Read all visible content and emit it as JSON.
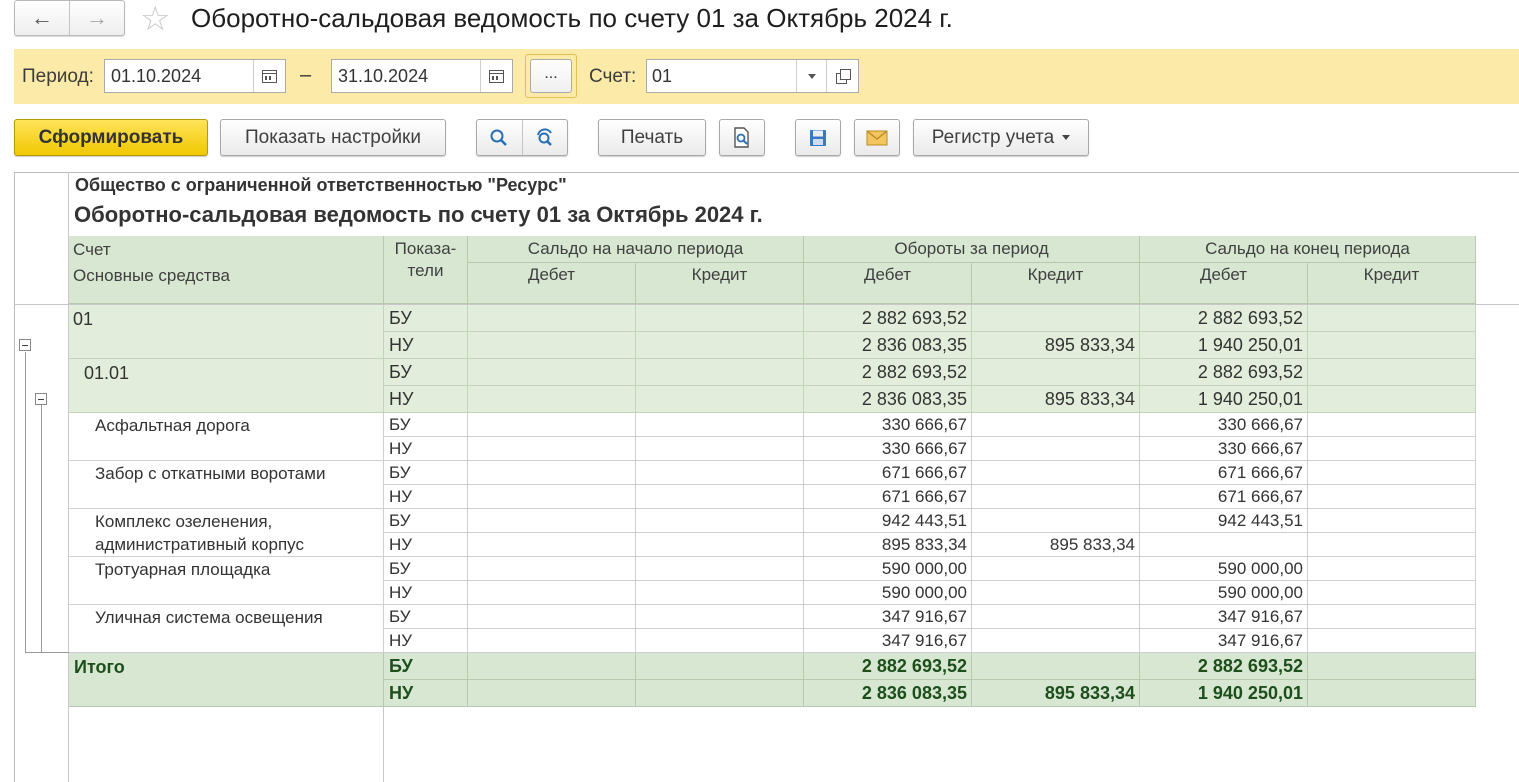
{
  "window": {
    "title": "Оборотно-сальдовая ведомость по счету 01 за Октябрь 2024 г.",
    "back_icon": "arrow-left",
    "forward_icon": "arrow-right",
    "favorite_icon": "star"
  },
  "filters": {
    "period_label": "Период:",
    "date_from": "01.10.2024",
    "date_to": "31.10.2024",
    "dash": "–",
    "period_choose": "...",
    "account_label": "Счет:",
    "account": "01"
  },
  "toolbar": {
    "generate": "Сформировать",
    "show_settings": "Показать настройки",
    "print": "Печать",
    "registry": "Регистр учета"
  },
  "report": {
    "organization": "Общество с ограниченной ответственностью \"Ресурс\"",
    "title": "Оборотно-сальдовая ведомость по счету 01 за Октябрь 2024 г.",
    "header": {
      "account": "Счет",
      "subconto": "Основные средства",
      "indicators_1": "Показа-",
      "indicators_2": "тели",
      "opening": "Сальдо на начало периода",
      "turnover": "Обороты за период",
      "closing": "Сальдо на конец периода",
      "debit": "Дебет",
      "credit": "Кредит"
    },
    "rows": [
      {
        "name": "01",
        "bu": {
          "t_dt": "2 882 693,52",
          "t_kt": "",
          "c_dt": "2 882 693,52"
        },
        "nu": {
          "t_dt": "2 836 083,35",
          "t_kt": "895 833,34",
          "c_dt": "1 940 250,01"
        }
      },
      {
        "name": "01.01",
        "bu": {
          "t_dt": "2 882 693,52",
          "t_kt": "",
          "c_dt": "2 882 693,52"
        },
        "nu": {
          "t_dt": "2 836 083,35",
          "t_kt": "895 833,34",
          "c_dt": "1 940 250,01"
        }
      },
      {
        "name": "Асфальтная дорога",
        "bu": {
          "t_dt": "330 666,67",
          "t_kt": "",
          "c_dt": "330 666,67"
        },
        "nu": {
          "t_dt": "330 666,67",
          "t_kt": "",
          "c_dt": "330 666,67"
        }
      },
      {
        "name": "Забор с откатными воротами",
        "bu": {
          "t_dt": "671 666,67",
          "t_kt": "",
          "c_dt": "671 666,67"
        },
        "nu": {
          "t_dt": "671 666,67",
          "t_kt": "",
          "c_dt": "671 666,67"
        }
      },
      {
        "name": "Комплекс озеленения,",
        "name2": "административный корпус",
        "bu": {
          "t_dt": "942 443,51",
          "t_kt": "",
          "c_dt": "942 443,51"
        },
        "nu": {
          "t_dt": "895 833,34",
          "t_kt": "895 833,34",
          "c_dt": ""
        }
      },
      {
        "name": "Тротуарная площадка",
        "bu": {
          "t_dt": "590 000,00",
          "t_kt": "",
          "c_dt": "590 000,00"
        },
        "nu": {
          "t_dt": "590 000,00",
          "t_kt": "",
          "c_dt": "590 000,00"
        }
      },
      {
        "name": "Уличная система освещения",
        "bu": {
          "t_dt": "347 916,67",
          "t_kt": "",
          "c_dt": "347 916,67"
        },
        "nu": {
          "t_dt": "347 916,67",
          "t_kt": "",
          "c_dt": "347 916,67"
        }
      }
    ],
    "total": {
      "name": "Итого",
      "bu": {
        "t_dt": "2 882 693,52",
        "t_kt": "",
        "c_dt": "2 882 693,52"
      },
      "nu": {
        "t_dt": "2 836 083,35",
        "t_kt": "895 833,34",
        "c_dt": "1 940 250,01"
      }
    },
    "bu_label": "БУ",
    "nu_label": "НУ"
  }
}
